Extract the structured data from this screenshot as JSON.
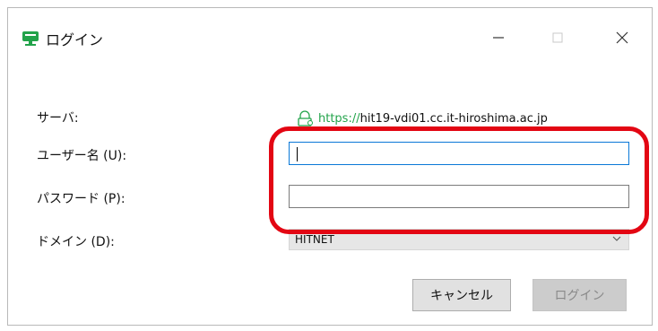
{
  "window": {
    "title": "ログイン",
    "accent_color": "#22a34a",
    "minimize_icon": "minimize-icon",
    "maximize_icon": "maximize-icon",
    "close_icon": "close-icon"
  },
  "form": {
    "server_label": "サーバ:",
    "server_url_prefix": "https://",
    "server_url_host": "hit19-vdi01.cc.it-hiroshima.ac.jp",
    "username_label": "ユーザー名 (U):",
    "username_value": "",
    "password_label": "パスワード (P):",
    "password_value": "",
    "domain_label": "ドメイン (D):",
    "domain_value": "HITNET"
  },
  "buttons": {
    "cancel_label": "キャンセル",
    "login_label": "ログイン"
  },
  "annotation": {
    "highlight_color": "#e30613"
  }
}
